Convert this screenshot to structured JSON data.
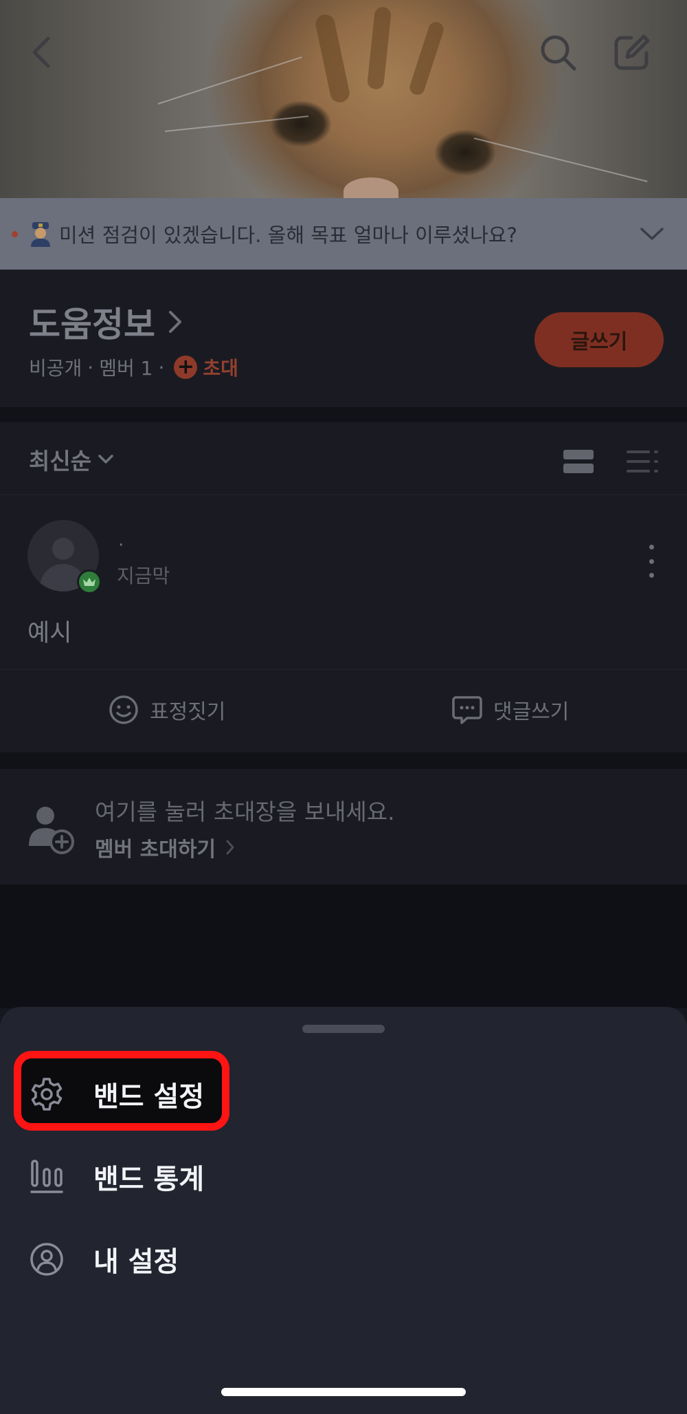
{
  "header": {
    "back_icon": "chevron-left-icon",
    "search_icon": "search-icon",
    "edit_icon": "compose-icon"
  },
  "notice": {
    "text": "미션 점검이 있겠습니다. 올해 목표 얼마나 이루셨나요?",
    "emoji": "police-officer-emoji"
  },
  "band": {
    "title": "도움정보",
    "visibility": "비공개",
    "members_label": "멤버 1",
    "invite_label": "초대",
    "write_button": "글쓰기"
  },
  "sort": {
    "label": "최신순"
  },
  "post": {
    "author": "·",
    "time": "지금막",
    "content": "예시"
  },
  "actions": {
    "react_label": "표정짓기",
    "comment_label": "댓글쓰기"
  },
  "invite_card": {
    "line1": "여기를 눌러 초대장을 보내세요.",
    "line2": "멤버 초대하기"
  },
  "sheet": {
    "items": [
      {
        "label": "밴드 설정",
        "icon": "gear-icon"
      },
      {
        "label": "밴드 통계",
        "icon": "bar-chart-icon"
      },
      {
        "label": "내 설정",
        "icon": "user-circle-icon"
      }
    ]
  },
  "colors": {
    "accent": "#7f2f21",
    "highlight": "#ff1414",
    "sheet_bg": "#22242f"
  }
}
